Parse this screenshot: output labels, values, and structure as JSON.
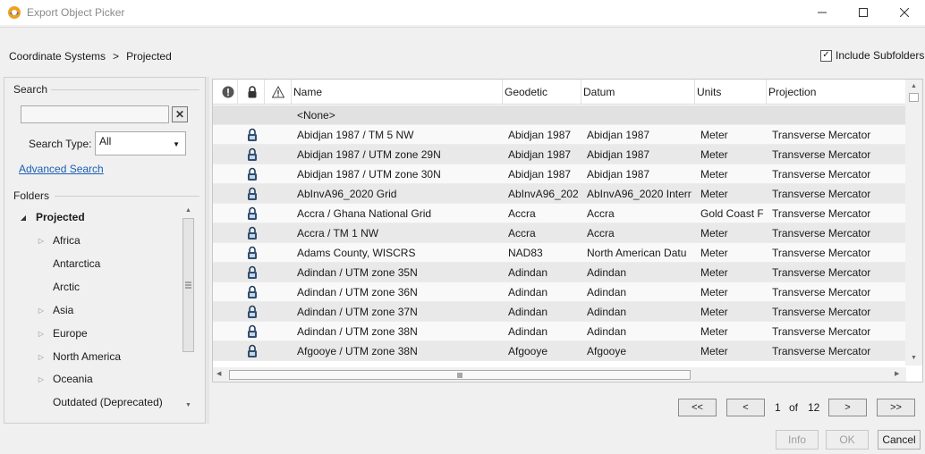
{
  "window": {
    "title": "Export Object Picker"
  },
  "breadcrumb": {
    "root": "Coordinate Systems",
    "separator": ">",
    "current": "Projected"
  },
  "include_subfolders": {
    "label": "Include Subfolders",
    "checked": true,
    "check_glyph": "✓"
  },
  "search": {
    "group_label": "Search",
    "input_value": "",
    "clear_glyph": "✕",
    "type_label": "Search Type:",
    "type_value": "All",
    "advanced_link": "Advanced Search"
  },
  "folders": {
    "group_label": "Folders",
    "items": [
      {
        "label": "Projected",
        "expanded": true,
        "has_children": true,
        "bold": true
      },
      {
        "label": "Africa",
        "has_children": true
      },
      {
        "label": "Antarctica",
        "has_children": false
      },
      {
        "label": "Arctic",
        "has_children": false
      },
      {
        "label": "Asia",
        "has_children": true
      },
      {
        "label": "Europe",
        "has_children": true
      },
      {
        "label": "North America",
        "has_children": true
      },
      {
        "label": "Oceania",
        "has_children": true
      },
      {
        "label": "Outdated (Deprecated)",
        "has_children": false
      }
    ]
  },
  "grid": {
    "columns": [
      "Name",
      "Geodetic",
      "Datum",
      "Units",
      "Projection"
    ],
    "icon_columns": [
      "info-icon",
      "lock-icon",
      "warning-icon"
    ],
    "none_row": "<None>",
    "rows": [
      {
        "name": "Abidjan 1987 / TM 5 NW",
        "geodetic": "Abidjan 1987",
        "datum": "Abidjan 1987",
        "units": "Meter",
        "projection": "Transverse Mercator"
      },
      {
        "name": "Abidjan 1987 / UTM zone 29N",
        "geodetic": "Abidjan 1987",
        "datum": "Abidjan 1987",
        "units": "Meter",
        "projection": "Transverse Mercator"
      },
      {
        "name": "Abidjan 1987 / UTM zone 30N",
        "geodetic": "Abidjan 1987",
        "datum": "Abidjan 1987",
        "units": "Meter",
        "projection": "Transverse Mercator"
      },
      {
        "name": "AbInvA96_2020 Grid",
        "geodetic": "AbInvA96_202",
        "datum": "AbInvA96_2020 Intern",
        "units": "Meter",
        "projection": "Transverse Mercator"
      },
      {
        "name": "Accra / Ghana National Grid",
        "geodetic": "Accra",
        "datum": "Accra",
        "units": "Gold Coast F",
        "projection": "Transverse Mercator"
      },
      {
        "name": "Accra / TM 1 NW",
        "geodetic": "Accra",
        "datum": "Accra",
        "units": "Meter",
        "projection": "Transverse Mercator"
      },
      {
        "name": "Adams County, WISCRS",
        "geodetic": "NAD83",
        "datum": "North American Datu",
        "units": "Meter",
        "projection": "Transverse Mercator"
      },
      {
        "name": "Adindan / UTM zone 35N",
        "geodetic": "Adindan",
        "datum": "Adindan",
        "units": "Meter",
        "projection": "Transverse Mercator"
      },
      {
        "name": "Adindan / UTM zone 36N",
        "geodetic": "Adindan",
        "datum": "Adindan",
        "units": "Meter",
        "projection": "Transverse Mercator"
      },
      {
        "name": "Adindan / UTM zone 37N",
        "geodetic": "Adindan",
        "datum": "Adindan",
        "units": "Meter",
        "projection": "Transverse Mercator"
      },
      {
        "name": "Adindan / UTM zone 38N",
        "geodetic": "Adindan",
        "datum": "Adindan",
        "units": "Meter",
        "projection": "Transverse Mercator"
      },
      {
        "name": "Afgooye / UTM zone 38N",
        "geodetic": "Afgooye",
        "datum": "Afgooye",
        "units": "Meter",
        "projection": "Transverse Mercator"
      }
    ]
  },
  "pagination": {
    "first": "<<",
    "prev": "<",
    "page": "1",
    "of": "of",
    "total": "12",
    "next": ">",
    "last": ">>"
  },
  "buttons": {
    "info": "Info",
    "ok": "OK",
    "cancel": "Cancel"
  },
  "colors": {
    "accent_link": "#1a5fb4",
    "app_icon_orange": "#f0a020",
    "app_icon_blue": "#2c6fb7"
  }
}
